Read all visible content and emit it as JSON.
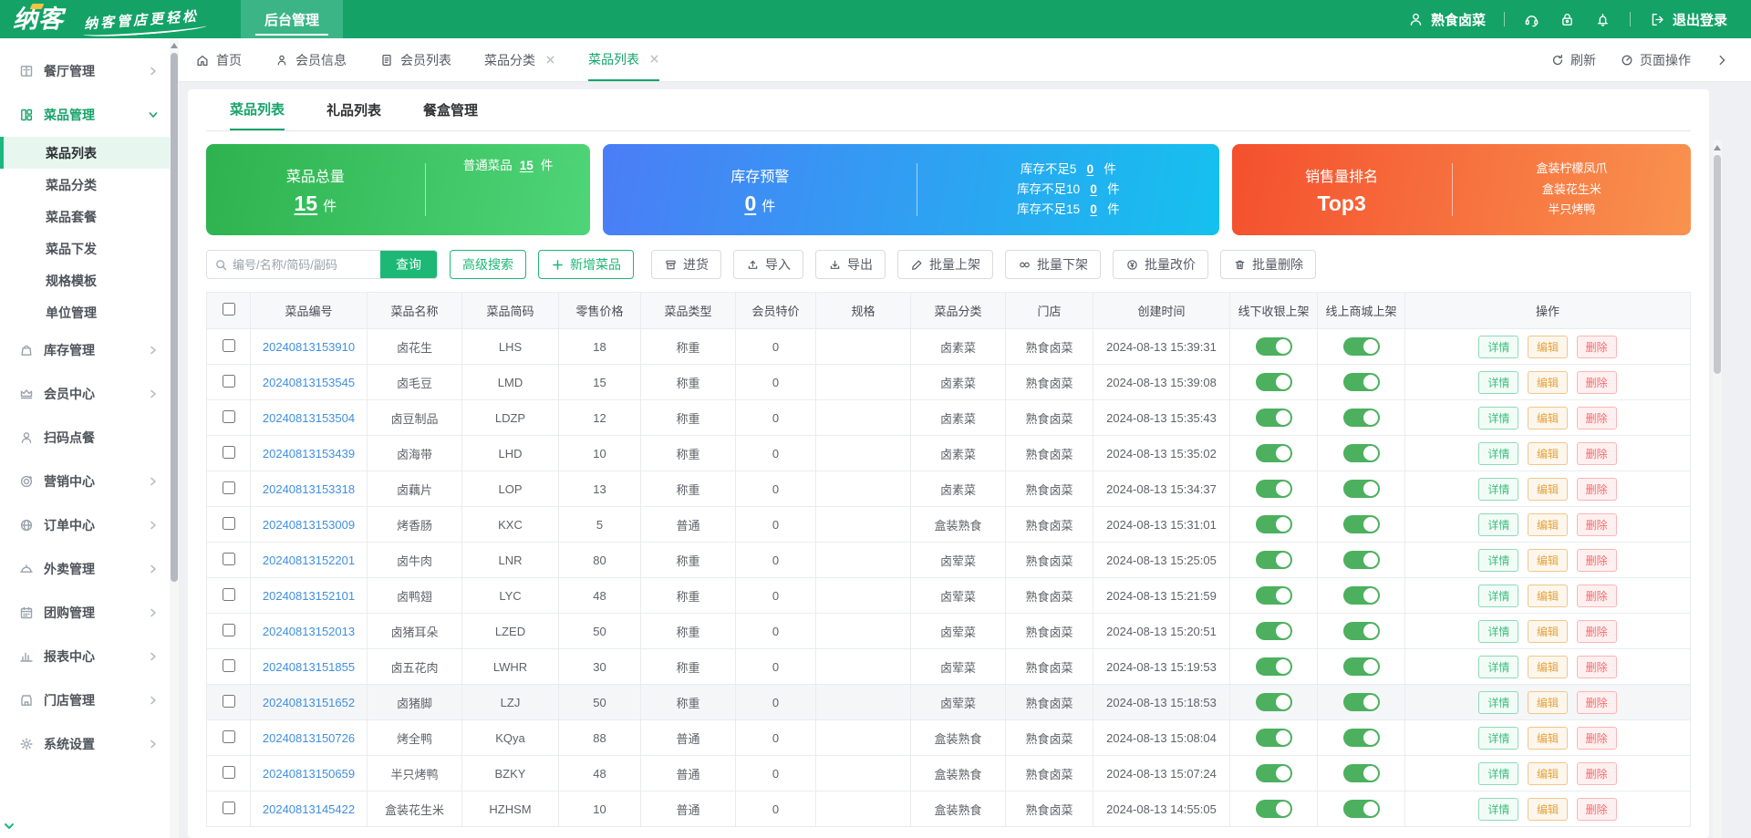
{
  "brand": {
    "logo": "纳客",
    "slogan": "纳客管店更轻松",
    "nav_tab": "后台管理"
  },
  "topbar": {
    "user": "熟食卤菜",
    "logout": "退出登录"
  },
  "sidebar": {
    "items": [
      {
        "label": "餐厅管理"
      },
      {
        "label": "菜品管理"
      },
      {
        "label": "库存管理"
      },
      {
        "label": "会员中心"
      },
      {
        "label": "扫码点餐"
      },
      {
        "label": "营销中心"
      },
      {
        "label": "订单中心"
      },
      {
        "label": "外卖管理"
      },
      {
        "label": "团购管理"
      },
      {
        "label": "报表中心"
      },
      {
        "label": "门店管理"
      },
      {
        "label": "系统设置"
      }
    ],
    "submenu": [
      "菜品列表",
      "菜品分类",
      "菜品套餐",
      "菜品下发",
      "规格模板",
      "单位管理"
    ]
  },
  "tabs": {
    "items": [
      "首页",
      "会员信息",
      "会员列表",
      "菜品分类",
      "菜品列表"
    ],
    "refresh": "刷新",
    "page_ops": "页面操作"
  },
  "subtabs": [
    "菜品列表",
    "礼品列表",
    "餐盒管理"
  ],
  "cards": {
    "total": {
      "title": "菜品总量",
      "value": "15",
      "unit": "件",
      "normal_label": "普通菜品",
      "normal_value": "15",
      "normal_unit": "件"
    },
    "stock": {
      "title": "库存预警",
      "value": "0",
      "unit": "件",
      "rows": [
        {
          "label": "库存不足5",
          "value": "0",
          "unit": "件"
        },
        {
          "label": "库存不足10",
          "value": "0",
          "unit": "件"
        },
        {
          "label": "库存不足15",
          "value": "0",
          "unit": "件"
        }
      ]
    },
    "sales": {
      "title": "销售量排名",
      "value": "Top3",
      "items": [
        "盒装柠檬凤爪",
        "盒装花生米",
        "半只烤鸭"
      ]
    }
  },
  "toolbar": {
    "search_placeholder": "编号/名称/简码/副码",
    "search": "查询",
    "advanced": "高级搜索",
    "add": "新增菜品",
    "purchase": "进货",
    "import": "导入",
    "export": "导出",
    "batch_on": "批量上架",
    "batch_off": "批量下架",
    "batch_price": "批量改价",
    "batch_delete": "批量删除"
  },
  "table": {
    "columns": [
      "菜品编号",
      "菜品名称",
      "菜品简码",
      "零售价格",
      "菜品类型",
      "会员特价",
      "规格",
      "菜品分类",
      "门店",
      "创建时间",
      "线下收银上架",
      "线上商城上架",
      "操作"
    ],
    "actions": [
      "详情",
      "编辑",
      "删除"
    ],
    "rows": [
      {
        "id": "20240813153910",
        "name": "卤花生",
        "code": "LHS",
        "price": "18",
        "type": "称重",
        "member_price": "0",
        "spec": "",
        "category": "卤素菜",
        "store": "熟食卤菜",
        "created": "2024-08-13 15:39:31",
        "highlight": false
      },
      {
        "id": "20240813153545",
        "name": "卤毛豆",
        "code": "LMD",
        "price": "15",
        "type": "称重",
        "member_price": "0",
        "spec": "",
        "category": "卤素菜",
        "store": "熟食卤菜",
        "created": "2024-08-13 15:39:08",
        "highlight": false
      },
      {
        "id": "20240813153504",
        "name": "卤豆制品",
        "code": "LDZP",
        "price": "12",
        "type": "称重",
        "member_price": "0",
        "spec": "",
        "category": "卤素菜",
        "store": "熟食卤菜",
        "created": "2024-08-13 15:35:43",
        "highlight": false
      },
      {
        "id": "20240813153439",
        "name": "卤海带",
        "code": "LHD",
        "price": "10",
        "type": "称重",
        "member_price": "0",
        "spec": "",
        "category": "卤素菜",
        "store": "熟食卤菜",
        "created": "2024-08-13 15:35:02",
        "highlight": false
      },
      {
        "id": "20240813153318",
        "name": "卤藕片",
        "code": "LOP",
        "price": "13",
        "type": "称重",
        "member_price": "0",
        "spec": "",
        "category": "卤素菜",
        "store": "熟食卤菜",
        "created": "2024-08-13 15:34:37",
        "highlight": false
      },
      {
        "id": "20240813153009",
        "name": "烤香肠",
        "code": "KXC",
        "price": "5",
        "type": "普通",
        "member_price": "0",
        "spec": "",
        "category": "盒装熟食",
        "store": "熟食卤菜",
        "created": "2024-08-13 15:31:01",
        "highlight": false
      },
      {
        "id": "20240813152201",
        "name": "卤牛肉",
        "code": "LNR",
        "price": "80",
        "type": "称重",
        "member_price": "0",
        "spec": "",
        "category": "卤荤菜",
        "store": "熟食卤菜",
        "created": "2024-08-13 15:25:05",
        "highlight": false
      },
      {
        "id": "20240813152101",
        "name": "卤鸭翅",
        "code": "LYC",
        "price": "48",
        "type": "称重",
        "member_price": "0",
        "spec": "",
        "category": "卤荤菜",
        "store": "熟食卤菜",
        "created": "2024-08-13 15:21:59",
        "highlight": false
      },
      {
        "id": "20240813152013",
        "name": "卤猪耳朵",
        "code": "LZED",
        "price": "50",
        "type": "称重",
        "member_price": "0",
        "spec": "",
        "category": "卤荤菜",
        "store": "熟食卤菜",
        "created": "2024-08-13 15:20:51",
        "highlight": false
      },
      {
        "id": "20240813151855",
        "name": "卤五花肉",
        "code": "LWHR",
        "price": "30",
        "type": "称重",
        "member_price": "0",
        "spec": "",
        "category": "卤荤菜",
        "store": "熟食卤菜",
        "created": "2024-08-13 15:19:53",
        "highlight": false
      },
      {
        "id": "20240813151652",
        "name": "卤猪脚",
        "code": "LZJ",
        "price": "50",
        "type": "称重",
        "member_price": "0",
        "spec": "",
        "category": "卤荤菜",
        "store": "熟食卤菜",
        "created": "2024-08-13 15:18:53",
        "highlight": true
      },
      {
        "id": "20240813150726",
        "name": "烤全鸭",
        "code": "KQya",
        "price": "88",
        "type": "普通",
        "member_price": "0",
        "spec": "",
        "category": "盒装熟食",
        "store": "熟食卤菜",
        "created": "2024-08-13 15:08:04",
        "highlight": false
      },
      {
        "id": "20240813150659",
        "name": "半只烤鸭",
        "code": "BZKY",
        "price": "48",
        "type": "普通",
        "member_price": "0",
        "spec": "",
        "category": "盒装熟食",
        "store": "熟食卤菜",
        "created": "2024-08-13 15:07:24",
        "highlight": false
      },
      {
        "id": "20240813145422",
        "name": "盒装花生米",
        "code": "HZHSM",
        "price": "10",
        "type": "普通",
        "member_price": "0",
        "spec": "",
        "category": "盒装熟食",
        "store": "熟食卤菜",
        "created": "2024-08-13 14:55:05",
        "highlight": false
      }
    ]
  },
  "colors": {
    "brand_green": "#17a36a",
    "header_green": "#14a267",
    "button_green": "#1db876",
    "link_blue": "#3f8fe0",
    "toggle_green": "#4cb05f",
    "card_green_from": "#2eb24f",
    "card_green_to": "#4ed578",
    "card_blue_from": "#4b7df6",
    "card_blue_to": "#15c1ee",
    "card_orange_from": "#f4502e",
    "card_orange_to": "#f9924f",
    "action_detail": "#3dbd7d",
    "action_edit": "#e6a23c",
    "action_delete": "#f56c6c"
  }
}
